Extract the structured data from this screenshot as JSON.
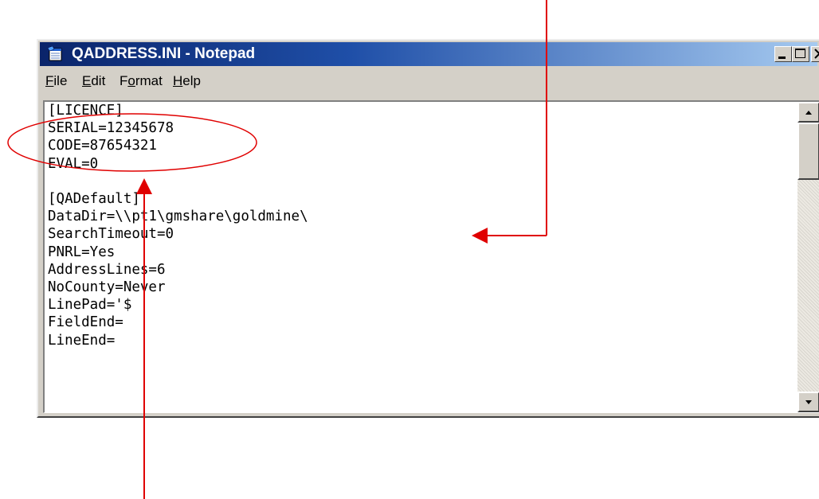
{
  "window": {
    "title": "QADDRESS.INI - Notepad",
    "icon": "notepad-icon",
    "buttons": {
      "minimize": "minimize-icon",
      "maximize": "maximize-icon",
      "close": "close-icon"
    }
  },
  "menu": {
    "file": {
      "accel": "F",
      "rest": "ile"
    },
    "edit": {
      "accel": "E",
      "rest": "dit"
    },
    "format": {
      "pre": "F",
      "accel": "o",
      "rest": "rmat"
    },
    "help": {
      "accel": "H",
      "rest": "elp"
    }
  },
  "editor": {
    "lines": [
      "[LICENCE]",
      "SERIAL=12345678",
      "CODE=87654321",
      "EVAL=0",
      "",
      "[QADefault]",
      "DataDir=\\\\pt1\\gmshare\\goldmine\\",
      "SearchTimeout=0",
      "PNRL=Yes",
      "AddressLines=6",
      "NoCounty=Never",
      "LinePad='$",
      "FieldEnd=",
      "LineEnd="
    ]
  },
  "annotation": {
    "color": "#e00000"
  }
}
